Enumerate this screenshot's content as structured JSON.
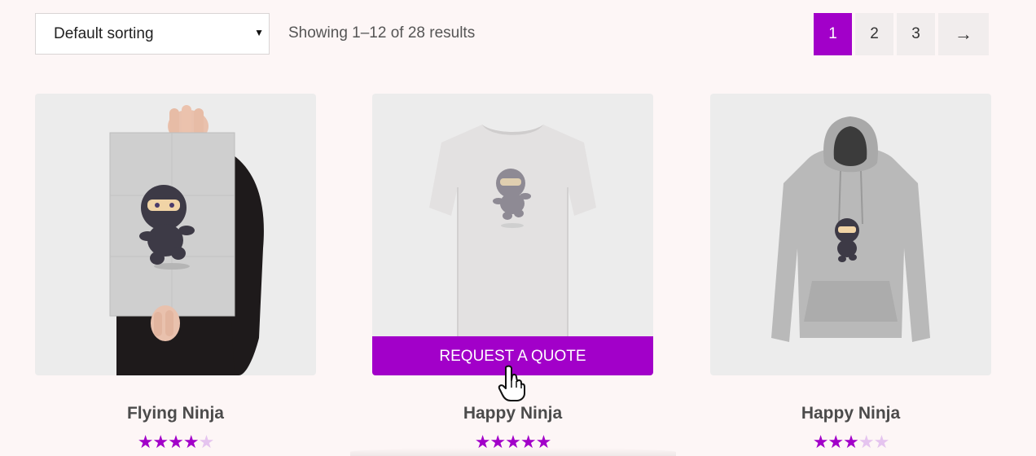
{
  "toolbar": {
    "sort_label": "Default sorting",
    "result_count": "Showing 1–12 of 28 results"
  },
  "pagination": {
    "pages": [
      "1",
      "2",
      "3"
    ],
    "current": "1",
    "next_label": "→"
  },
  "products": [
    {
      "title": "Flying Ninja",
      "rating_out_of_5": 4,
      "image_icon": "poster-image"
    },
    {
      "title": "Happy Ninja",
      "rating_out_of_5": 5,
      "image_icon": "tshirt-image",
      "hover_button": "REQUEST A QUOTE"
    },
    {
      "title": "Happy Ninja",
      "rating_out_of_5": 3,
      "image_icon": "hoodie-image"
    }
  ],
  "colors": {
    "accent": "#a200c9",
    "accent_light": "#e5c4ef",
    "background": "#fdf6f6"
  }
}
